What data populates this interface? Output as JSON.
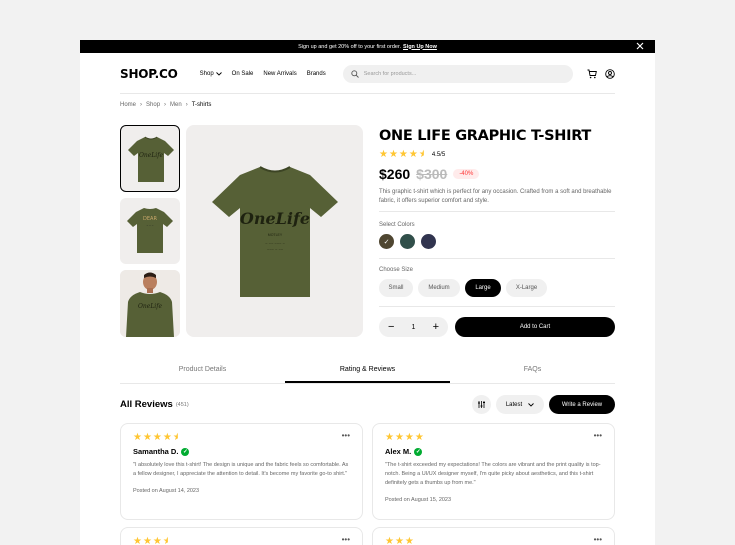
{
  "promo": {
    "text": "Sign up and get 20% off to your first order.",
    "link": "Sign Up Now"
  },
  "nav": {
    "logo": "SHOP.CO",
    "links": [
      "Shop",
      "On Sale",
      "New Arrivals",
      "Brands"
    ],
    "search_placeholder": "Search for products..."
  },
  "breadcrumb": [
    "Home",
    "Shop",
    "Men",
    "T-shirts"
  ],
  "product": {
    "title": "ONE LIFE GRAPHIC T-SHIRT",
    "rating": 4.5,
    "rating_text": "4.5/5",
    "price": "$260",
    "old_price": "$300",
    "discount": "-40%",
    "description": "This graphic t-shirt which is perfect for any occasion. Crafted from a soft and breathable fabric, it offers superior comfort and style.",
    "colors_label": "Select Colors",
    "colors": [
      "#4f4631",
      "#314f4a",
      "#31344f"
    ],
    "selected_color": 0,
    "sizes_label": "Choose Size",
    "sizes": [
      "Small",
      "Medium",
      "Large",
      "X-Large"
    ],
    "selected_size": "Large",
    "quantity": "1",
    "add_to_cart": "Add to Cart"
  },
  "tabs": [
    "Product Details",
    "Rating & Reviews",
    "FAQs"
  ],
  "reviews": {
    "title": "All Reviews",
    "count": "(451)",
    "sort": "Latest",
    "write": "Write a Review",
    "items": [
      {
        "rating": 4.5,
        "stars": "★★★★",
        "half": "★",
        "name": "Samantha D.",
        "text": "\"I absolutely love this t-shirt! The design is unique and the fabric feels so comfortable. As a fellow designer, I appreciate the attention to detail. It's become my favorite go-to shirt.\"",
        "date": "Posted on August 14, 2023"
      },
      {
        "rating": 4,
        "stars": "★★★★",
        "half": "",
        "name": "Alex M.",
        "text": "\"The t-shirt exceeded my expectations! The colors are vibrant and the print quality is top-notch. Being a UI/UX designer myself, I'm quite picky about aesthetics, and this t-shirt definitely gets a thumbs up from me.\"",
        "date": "Posted on August 15, 2023"
      },
      {
        "stars": "★★★",
        "half": "★"
      },
      {
        "stars": "★★★"
      }
    ]
  },
  "icons": {
    "cart": "cart-icon",
    "user": "user-icon",
    "search": "search-icon",
    "close": "close-icon",
    "filter": "filter-icon",
    "more": "more-icon",
    "verified": "verified-icon"
  }
}
